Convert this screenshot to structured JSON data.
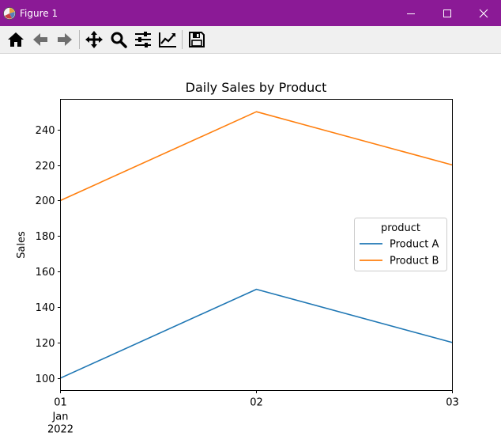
{
  "window": {
    "title": "Figure 1"
  },
  "toolbar": {
    "buttons": [
      {
        "name": "home-button",
        "icon": "home-icon"
      },
      {
        "name": "back-button",
        "icon": "arrow-left-icon"
      },
      {
        "name": "forward-button",
        "icon": "arrow-right-icon"
      },
      {
        "name": "pan-button",
        "icon": "move-icon"
      },
      {
        "name": "zoom-button",
        "icon": "magnifier-icon"
      },
      {
        "name": "configure-subplots-button",
        "icon": "sliders-icon"
      },
      {
        "name": "edit-axis-button",
        "icon": "line-chart-icon"
      },
      {
        "name": "save-button",
        "icon": "floppy-disk-icon"
      }
    ]
  },
  "colors": {
    "titlebar": "#8b1a96",
    "product_a": "#1f77b4",
    "product_b": "#ff7f0e"
  },
  "chart_data": {
    "type": "line",
    "title": "Daily Sales by Product",
    "xlabel": "",
    "ylabel": "Sales",
    "x": [
      "2022-01-01",
      "2022-01-02",
      "2022-01-03"
    ],
    "x_tick_labels": [
      {
        "text": "01",
        "sub": [
          "Jan",
          "2022"
        ]
      },
      {
        "text": "02",
        "sub": []
      },
      {
        "text": "03",
        "sub": []
      }
    ],
    "series": [
      {
        "name": "Product A",
        "values": [
          100,
          150,
          120
        ],
        "color": "#1f77b4"
      },
      {
        "name": "Product B",
        "values": [
          200,
          250,
          220
        ],
        "color": "#ff7f0e"
      }
    ],
    "ylim": [
      93,
      257
    ],
    "yticks": [
      100,
      120,
      140,
      160,
      180,
      200,
      220,
      240
    ],
    "legend": {
      "title": "product",
      "position": "center-right"
    },
    "grid": false
  }
}
